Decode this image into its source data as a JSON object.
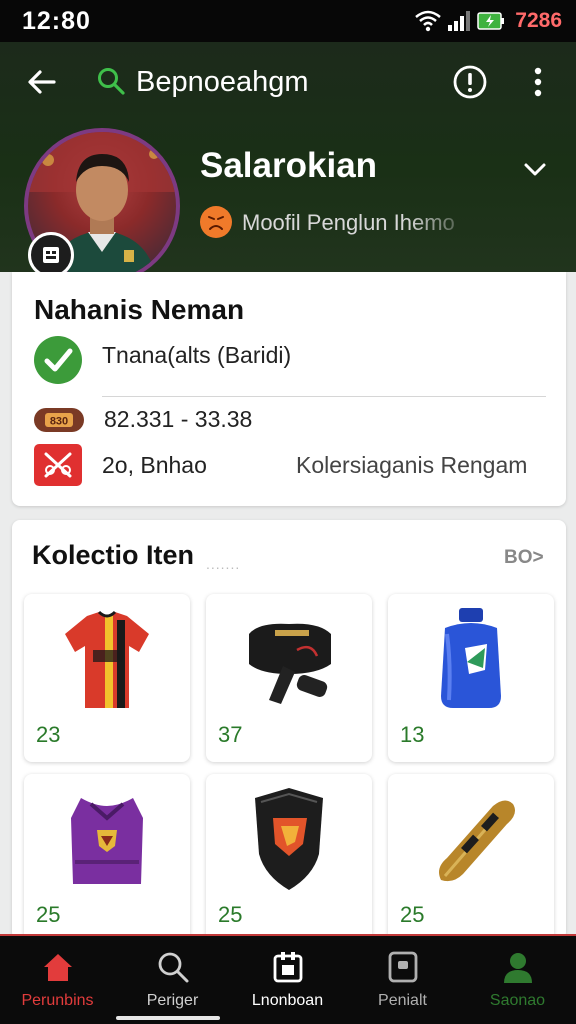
{
  "status_bar": {
    "time": "12:80",
    "battery": "7286"
  },
  "header": {
    "search_text": "Bepnoeahgm",
    "profile_name": "Salarokian",
    "subtitle": "Moofil Penglun Ihemo"
  },
  "info_card": {
    "title": "Nahanis Neman",
    "status": "Tnana(alts (Baridi)",
    "value_badge": "830",
    "value": "82.331 - 33.38",
    "count": "2o, Bnhao",
    "collection_link": "Kolersiaganis Rengam"
  },
  "collection": {
    "title": "Kolectio Iten",
    "title_dots": ".......",
    "see_all": "BO>",
    "items": [
      {
        "count": "23",
        "icon": "jersey-icon"
      },
      {
        "count": "37",
        "icon": "bag-icon"
      },
      {
        "count": "13",
        "icon": "bottle-icon"
      },
      {
        "count": "25",
        "icon": "vest-icon"
      },
      {
        "count": "25",
        "icon": "shield-icon"
      },
      {
        "count": "25",
        "icon": "trophy-icon"
      }
    ]
  },
  "bottom_nav": [
    {
      "label": "Perunbins",
      "icon": "home-icon",
      "color": "#e23c3c"
    },
    {
      "label": "Periger",
      "icon": "search-icon",
      "color": "#d0d0d0"
    },
    {
      "label": "Lnonboan",
      "icon": "calendar-icon",
      "color": "#ffffff"
    },
    {
      "label": "Penialt",
      "icon": "device-icon",
      "color": "#b0b0b0"
    },
    {
      "label": "Saonao",
      "icon": "profile-icon",
      "color": "#2f7a2f"
    }
  ],
  "colors": {
    "header_bg": "#1a3016",
    "accent_green": "#3c9b3a",
    "accent_red": "#e23c3c",
    "avatar_ring": "#7d3a82"
  }
}
